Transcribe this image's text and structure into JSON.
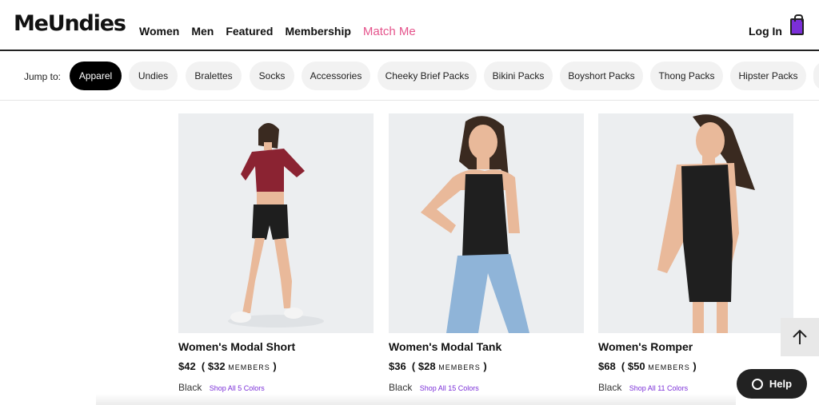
{
  "header": {
    "logo": "MeUndies",
    "nav": [
      "Women",
      "Men",
      "Featured",
      "Membership",
      "Match Me"
    ],
    "login": "Log In",
    "accent_color": "#7b2fd8"
  },
  "jump": {
    "label": "Jump to:",
    "pills": [
      "Apparel",
      "Undies",
      "Bralettes",
      "Socks",
      "Accessories",
      "Cheeky Brief Packs",
      "Bikini Packs",
      "Boyshort Packs",
      "Thong Packs",
      "Hipster Packs"
    ],
    "active": "Apparel"
  },
  "products": [
    {
      "name": "Women's Modal Short",
      "price": "$42",
      "member_price": "$32",
      "members_label": "MEMBERS",
      "color": "Black",
      "shop_all": "Shop All 5 Colors",
      "top_color": "#8b2332",
      "bottom_color": "#1e1e1e"
    },
    {
      "name": "Women's Modal Tank",
      "price": "$36",
      "member_price": "$28",
      "members_label": "MEMBERS",
      "color": "Black",
      "shop_all": "Shop All 15 Colors",
      "top_color": "#1f1f1f",
      "bottom_color": "#8fb4d8"
    },
    {
      "name": "Women's Romper",
      "price": "$68",
      "member_price": "$50",
      "members_label": "MEMBERS",
      "color": "Black",
      "shop_all": "Shop All 11 Colors",
      "top_color": "#1f1f1f",
      "bottom_color": "#1f1f1f"
    }
  ],
  "widgets": {
    "help": "Help",
    "back_to_top_icon": "arrow-up-icon",
    "help_icon": "chat-bubble-icon"
  }
}
